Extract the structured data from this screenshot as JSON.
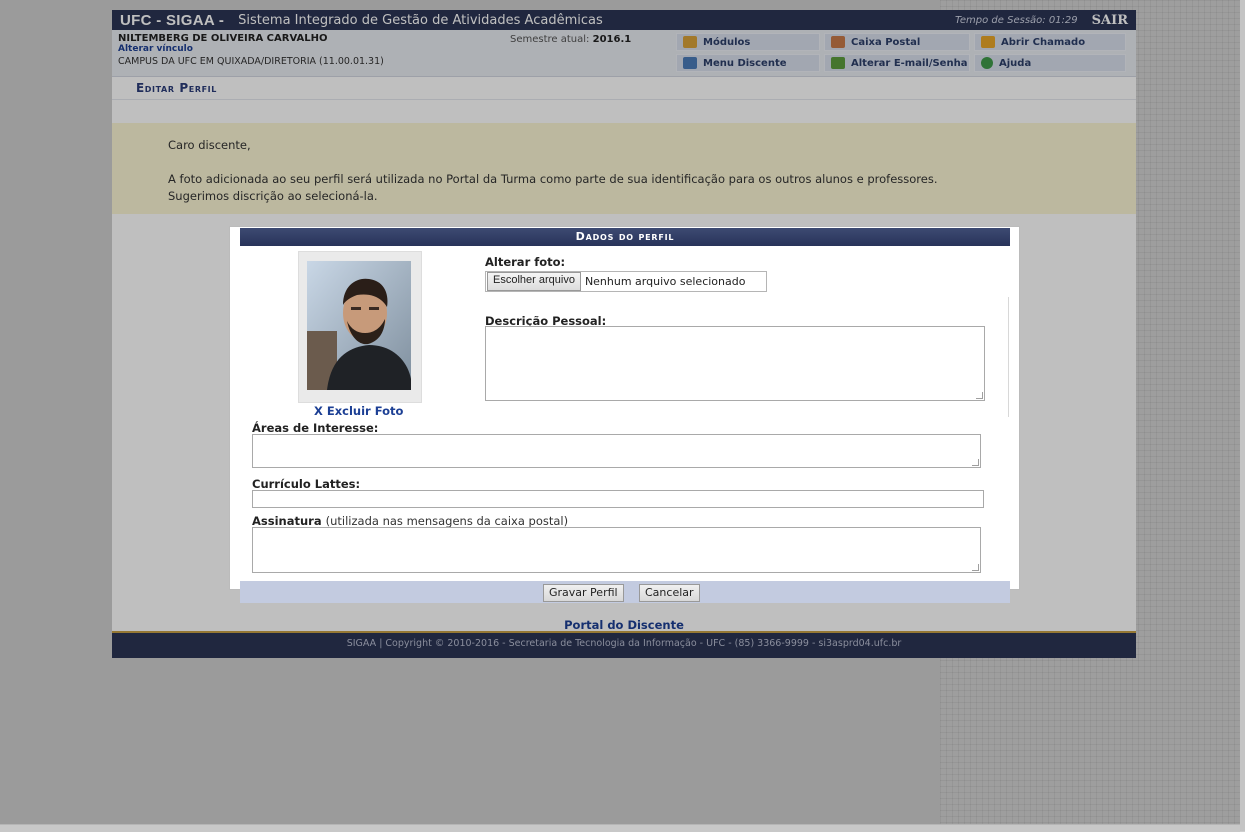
{
  "header": {
    "brand": "UFC - SIGAA -",
    "system_name": "Sistema Integrado de Gestão de Atividades Acadêmicas",
    "session_label": "Tempo de Sessão: 01:29",
    "logout_label": "SAIR"
  },
  "user": {
    "name": "NILTEMBERG DE OLIVEIRA CARVALHO",
    "change_link": "Alterar vínculo",
    "campus": "CAMPUS DA UFC EM QUIXADA/DIRETORIA (11.00.01.31)",
    "semester_label": "Semestre atual:",
    "semester_value": "2016.1"
  },
  "menu": {
    "modulos": "Módulos",
    "caixa_postal": "Caixa Postal",
    "abrir_chamado": "Abrir Chamado",
    "menu_discente": "Menu Discente",
    "alterar_email": "Alterar E-mail/Senha",
    "ajuda": "Ajuda"
  },
  "page_title": "Editar Perfil",
  "notice": {
    "greeting": "Caro discente,",
    "line1": "A foto adicionada ao seu perfil será utilizada no Portal da Turma como parte de sua identificação para os outros alunos e professores.",
    "line2": "Sugerimos discrição ao selecioná-la."
  },
  "modal": {
    "title": "Dados do perfil",
    "delete_photo": "X Excluir Foto",
    "change_photo_label": "Alterar foto:",
    "file_button": "Escolher arquivo",
    "file_status": "Nenhum arquivo selecionado",
    "description_label": "Descrição Pessoal:",
    "interests_label": "Áreas de Interesse:",
    "lattes_label": "Currículo Lattes:",
    "signature_label": "Assinatura",
    "signature_hint": "(utilizada nas mensagens da caixa postal)",
    "save_button": "Gravar Perfil",
    "cancel_button": "Cancelar"
  },
  "footer": {
    "portal_link": "Portal do Discente",
    "copyright": "SIGAA | Copyright © 2010-2016 - Secretaria de Tecnologia da Informação - UFC - (85) 3366-9999 - si3asprd04.ufc.br"
  },
  "colors": {
    "header_bg": "#2b3555",
    "link": "#1c3f94",
    "notice_bg": "#fbf6d5",
    "footer_border": "#c7a046"
  }
}
